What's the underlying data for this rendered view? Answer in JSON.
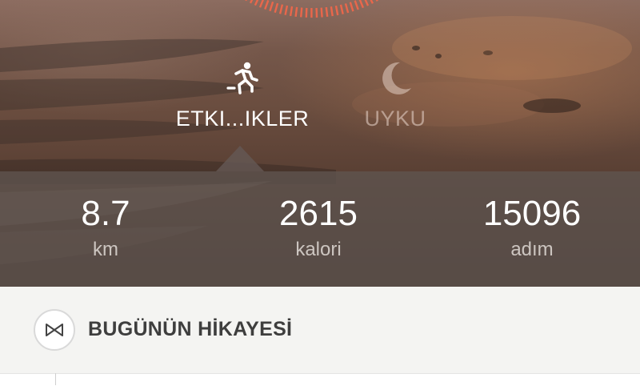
{
  "tabs": [
    {
      "label": "ETKI...IKLER",
      "icon": "running-icon",
      "active": true
    },
    {
      "label": "UYKU",
      "icon": "moon-icon",
      "active": false
    }
  ],
  "stats": {
    "distance": {
      "value": "8.7",
      "unit": "km"
    },
    "calories": {
      "value": "2615",
      "unit": "kalori"
    },
    "steps": {
      "value": "15096",
      "unit": "adım"
    }
  },
  "story": {
    "title": "BUGÜNÜN HİKAYESİ",
    "logo_icon": "bowtie-logo-icon"
  },
  "colors": {
    "progress_ring": "#e9674b",
    "stats_band": "#5f5450",
    "active_tab_text": "#ffffff",
    "inactive_tab_text": "#c9b3a8"
  }
}
